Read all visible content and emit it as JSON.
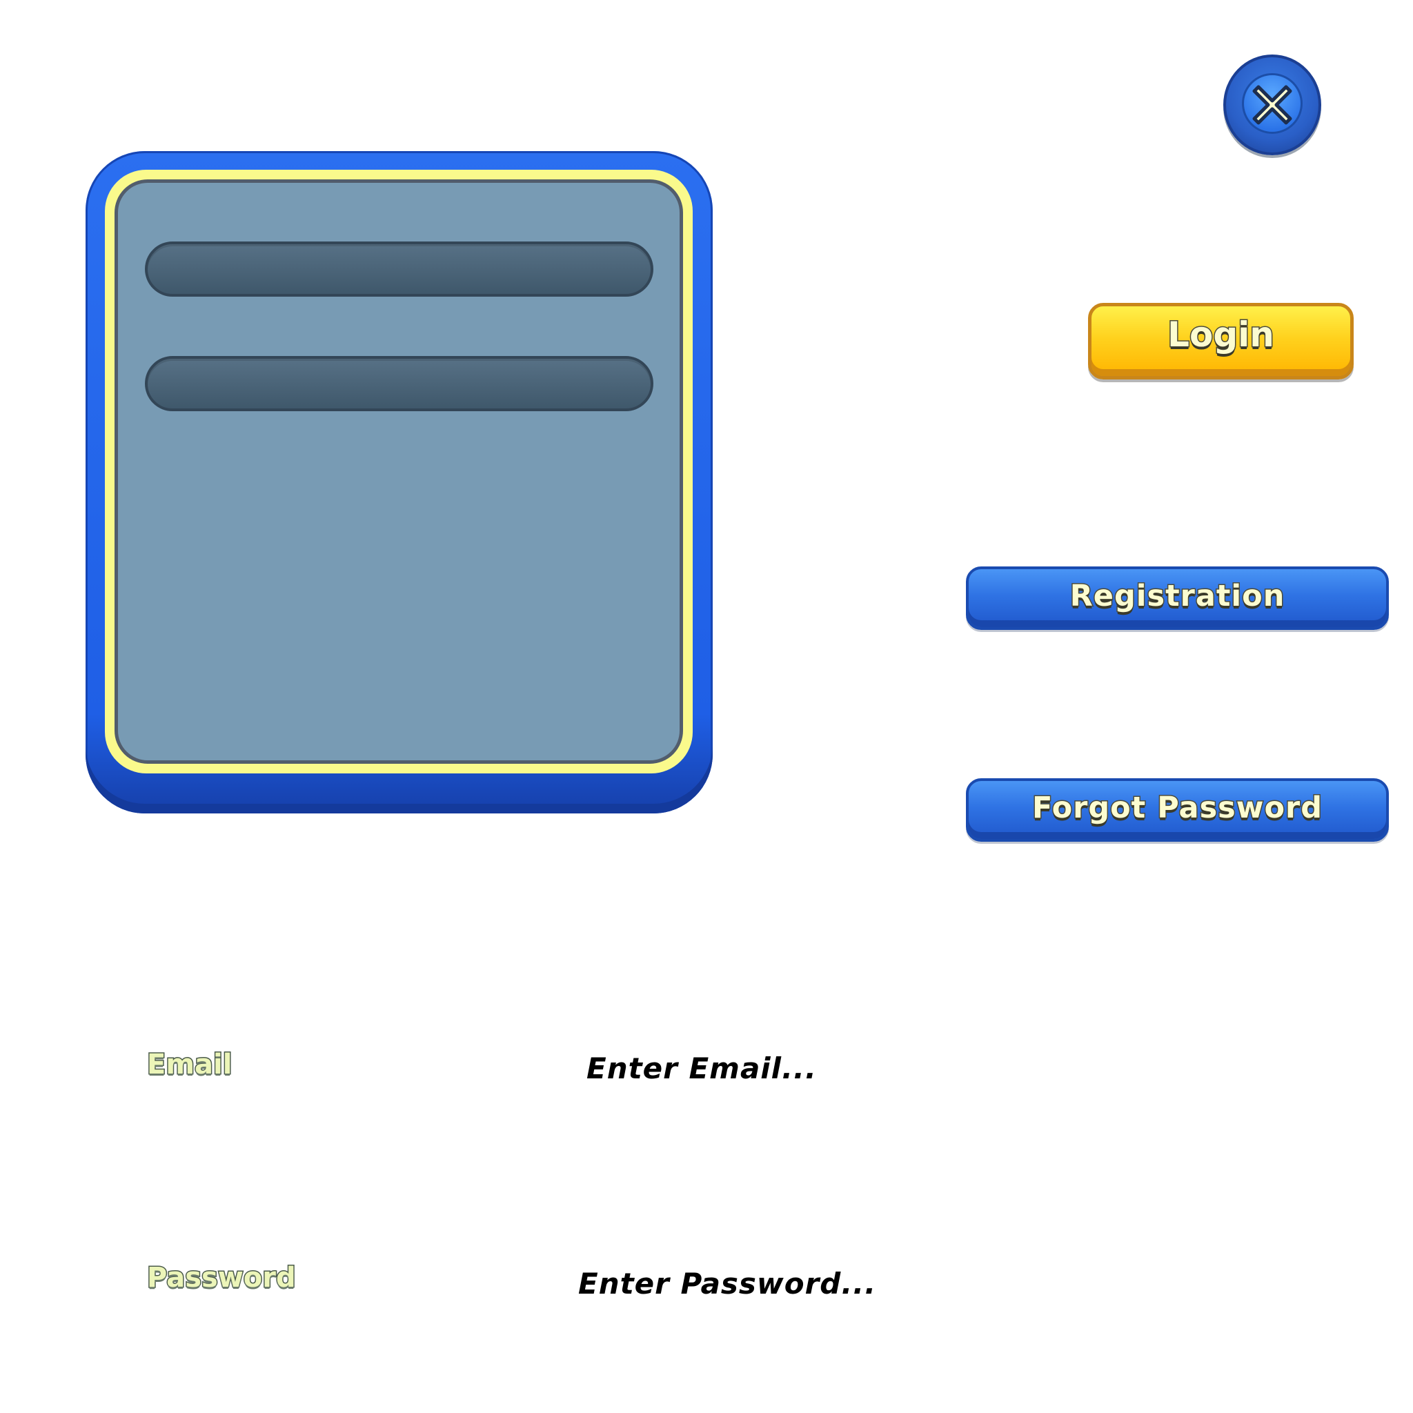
{
  "close_button": {
    "icon": "close-icon"
  },
  "login_button": {
    "label": "Login"
  },
  "registration_button": {
    "label": "Registration"
  },
  "forgot_password_button": {
    "label": "Forgot Password"
  },
  "email": {
    "label": "Email",
    "placeholder": "Enter Email..."
  },
  "password": {
    "label": "Password",
    "placeholder": "Enter Password..."
  },
  "colors": {
    "panel_blue": "#2b6ff0",
    "panel_rim": "#fafa8c",
    "panel_inner": "#789bb4",
    "slot": "#46607a",
    "login_yellow": "#ffd21e",
    "button_blue": "#2f73e4",
    "label_text": "#fcfcd0"
  }
}
